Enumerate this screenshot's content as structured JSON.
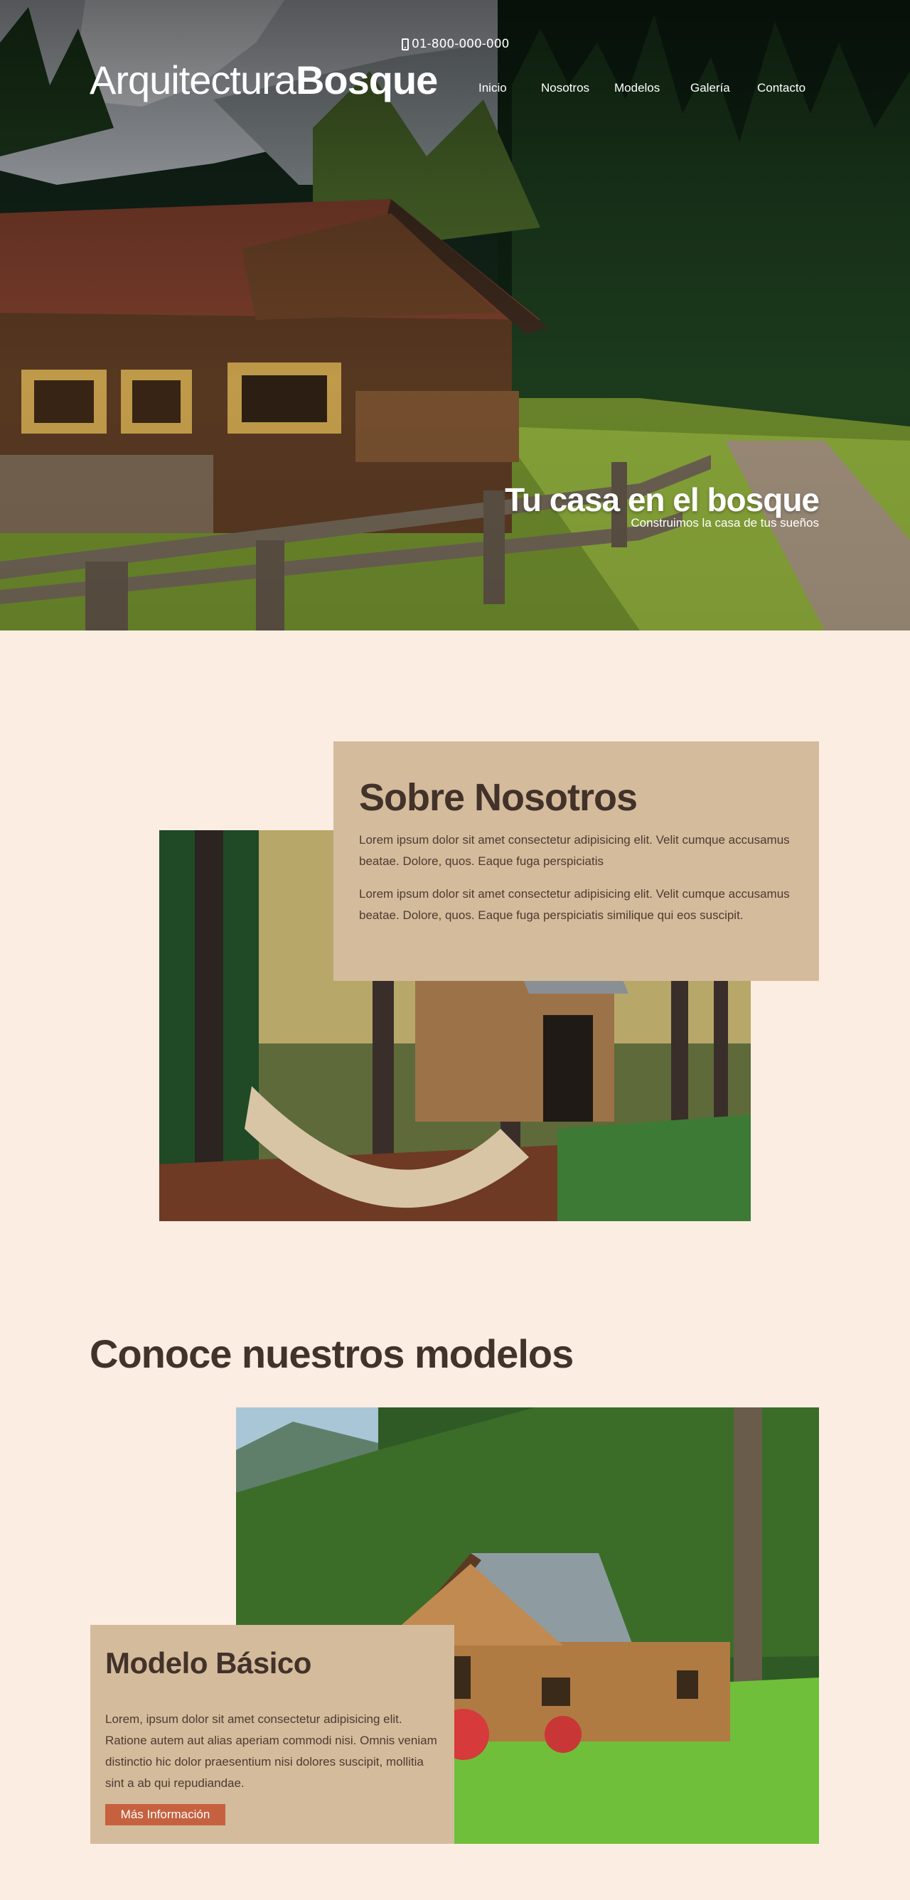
{
  "header": {
    "phone": "01-800-000-000",
    "logo_light": "Arquitectura",
    "logo_bold": "Bosque",
    "nav": [
      "Inicio",
      "Nosotros",
      "Modelos",
      "Galería",
      "Contacto"
    ]
  },
  "hero": {
    "title": "Tu casa en el bosque",
    "subtitle": "Construimos la casa de tus sueños"
  },
  "about": {
    "title": "Sobre Nosotros",
    "paragraphs": [
      "Lorem ipsum dolor sit amet consectetur adipisicing elit. Velit cumque accusamus beatae. Dolore, quos. Eaque fuga perspiciatis",
      "Lorem ipsum dolor sit amet consectetur adipisicing elit. Velit cumque accusamus beatae. Dolore, quos. Eaque fuga perspiciatis similique qui eos suscipit."
    ]
  },
  "models": {
    "title": "Conoce nuestros modelos",
    "card": {
      "title": "Modelo Básico",
      "text": "Lorem, ipsum dolor sit amet consectetur adipisicing elit. Ratione autem aut alias aperiam commodi nisi. Omnis veniam distinctio hic dolor praesentium nisi dolores suscipit, mollitia sint a ab qui repudiandae.",
      "button": "Más Información"
    }
  },
  "colors": {
    "background": "#fbede2",
    "card": "#d4bb9c",
    "heading": "#43322a",
    "button": "#c6613f"
  }
}
